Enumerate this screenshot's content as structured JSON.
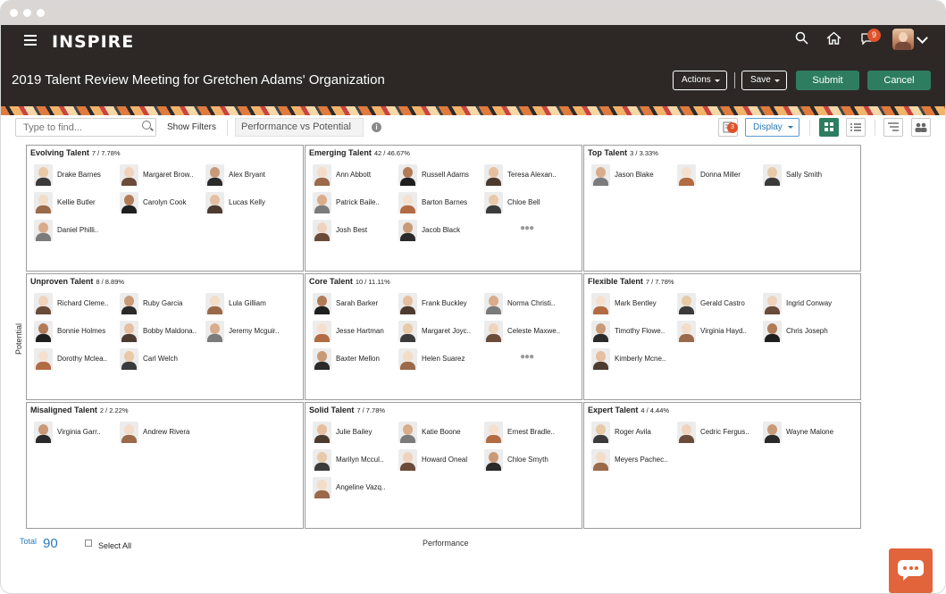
{
  "app": {
    "brand": "inspire",
    "notifications": "9"
  },
  "header": {
    "title": "2019 Talent Review Meeting for Gretchen Adams' Organization",
    "actions_label": "Actions",
    "save_label": "Save",
    "submit_label": "Submit",
    "cancel_label": "Cancel"
  },
  "toolbar": {
    "search_placeholder": "Type to find...",
    "show_filters": "Show Filters",
    "view": "Performance vs Potential",
    "filter_badge": "3",
    "display_label": "Display"
  },
  "colors": {
    "accent": "#2e7d61",
    "appbar": "#2d2826",
    "link": "#2b7ab8",
    "badge": "#e0522b"
  },
  "grid": {
    "cells": [
      {
        "title": "Evolving Talent",
        "count": "7 / 7.78%",
        "people": [
          "Drake Barnes",
          "Margaret Brow..",
          "Alex Bryant",
          "Kellie Butler",
          "Carolyn Cook",
          "Lucas Kelly",
          "Daniel Philli.."
        ],
        "more": false
      },
      {
        "title": "Emerging Talent",
        "count": "42 / 46.67%",
        "people": [
          "Ann Abbott",
          "Russell Adams",
          "Teresa Alexan..",
          "Patrick Baile..",
          "Barton Barnes",
          "Chloe Bell",
          "Josh Best",
          "Jacob Black"
        ],
        "more": true
      },
      {
        "title": "Top Talent",
        "count": "3 / 3.33%",
        "people": [
          "Jason Blake",
          "Donna Miller",
          "Sally Smith"
        ],
        "more": false
      },
      {
        "title": "Unproven Talent",
        "count": "8 / 8.89%",
        "people": [
          "Richard Cleme..",
          "Ruby Garcia",
          "Lula Gilliam",
          "Bonnie Holmes",
          "Bobby Maldona..",
          "Jeremy Mcguir..",
          "Dorothy Mclea..",
          "Carl Welch"
        ],
        "more": false
      },
      {
        "title": "Core Talent",
        "count": "10 / 11.11%",
        "people": [
          "Sarah Barker",
          "Frank Buckley",
          "Norma Christi..",
          "Jesse Hartman",
          "Margaret Joyc..",
          "Celeste Maxwe..",
          "Baxter Mellon",
          "Helen Suarez"
        ],
        "more": true
      },
      {
        "title": "Flexible Talent",
        "count": "7 / 7.78%",
        "people": [
          "Mark Bentley",
          "Gerald Castro",
          "Ingrid Conway",
          "Timothy Flowe..",
          "Virginia Hayd..",
          "Chris Joseph",
          "Kimberly Mcne.."
        ],
        "more": false
      },
      {
        "title": "Misaligned Talent",
        "count": "2 / 2.22%",
        "people": [
          "Virginia Garr..",
          "Andrew Rivera"
        ],
        "more": false
      },
      {
        "title": "Solid Talent",
        "count": "7 / 7.78%",
        "people": [
          "Julie Bailey",
          "Katie Boone",
          "Ernest Bradle..",
          "Marilyn Mccul..",
          "Howard Oneal",
          "Chloe Smyth",
          "Angeline Vazq.."
        ],
        "more": false
      },
      {
        "title": "Expert Talent",
        "count": "4 / 4.44%",
        "people": [
          "Roger Avila",
          "Cedric Fergus..",
          "Wayne Malone",
          "Meyers Pachec.."
        ],
        "more": false
      }
    ]
  },
  "axes": {
    "y_label": "Potential",
    "x_label": "Performance"
  },
  "footer": {
    "total_label": "Total",
    "total_value": "90",
    "select_all": "Select All"
  },
  "icons": [
    "menu-icon",
    "search-icon",
    "home-icon",
    "notifications-icon",
    "user-avatar",
    "chevron-down-icon",
    "info-icon",
    "filter-icon",
    "grid-view-icon",
    "list-view-icon",
    "sort-icon",
    "people-icon",
    "chat-icon"
  ]
}
